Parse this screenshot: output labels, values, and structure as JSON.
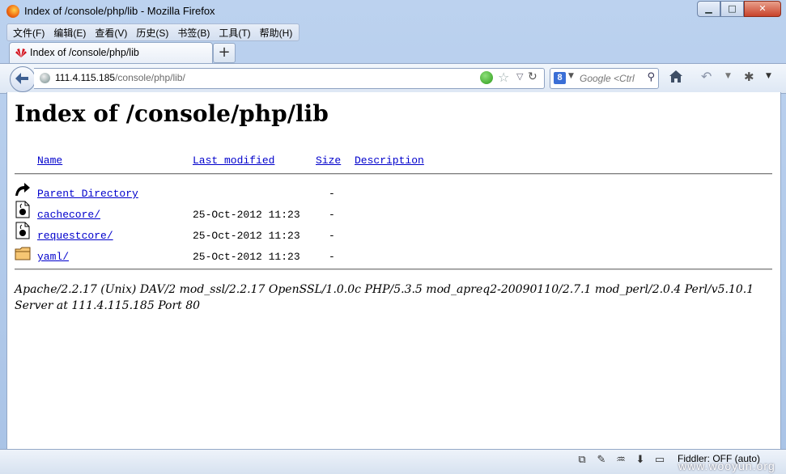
{
  "window": {
    "title": "Index of /console/php/lib - Mozilla Firefox",
    "controls": {
      "minimize": "▁",
      "maximize": "□",
      "close": "✕"
    }
  },
  "menu": [
    "文件(F)",
    "编辑(E)",
    "查看(V)",
    "历史(S)",
    "书签(B)",
    "工具(T)",
    "帮助(H)"
  ],
  "tab": {
    "label": "Index of /console/php/lib",
    "new_tab": "+"
  },
  "nav": {
    "url_host": "111.4.115.185",
    "url_path": "/console/php/lib/",
    "search_placeholder": "Google <Ctrl",
    "search_engine": "8"
  },
  "page": {
    "title": "Index of /console/php/lib",
    "columns": {
      "name": "Name",
      "modified": "Last modified",
      "size": "Size",
      "description": "Description"
    },
    "rows": [
      {
        "name": "Parent Directory",
        "modified": "",
        "size": "-",
        "icon": "back-arrow-icon"
      },
      {
        "name": "cachecore/",
        "modified": "25-Oct-2012 11:23",
        "size": "-",
        "icon": "unknown-file-icon"
      },
      {
        "name": "requestcore/",
        "modified": "25-Oct-2012 11:23",
        "size": "-",
        "icon": "unknown-file-icon"
      },
      {
        "name": "yaml/",
        "modified": "25-Oct-2012 11:23",
        "size": "-",
        "icon": "folder-icon"
      }
    ],
    "address": "Apache/2.2.17 (Unix) DAV/2 mod_ssl/2.2.17 OpenSSL/1.0.0c PHP/5.3.5 mod_apreq2-20090110/2.7.1 mod_perl/2.0.4 Perl/v5.10.1 Server at 111.4.115.185 Port 80"
  },
  "status": {
    "fiddler": "Fiddler: OFF (auto)"
  },
  "watermark": "www.wooyun.org"
}
